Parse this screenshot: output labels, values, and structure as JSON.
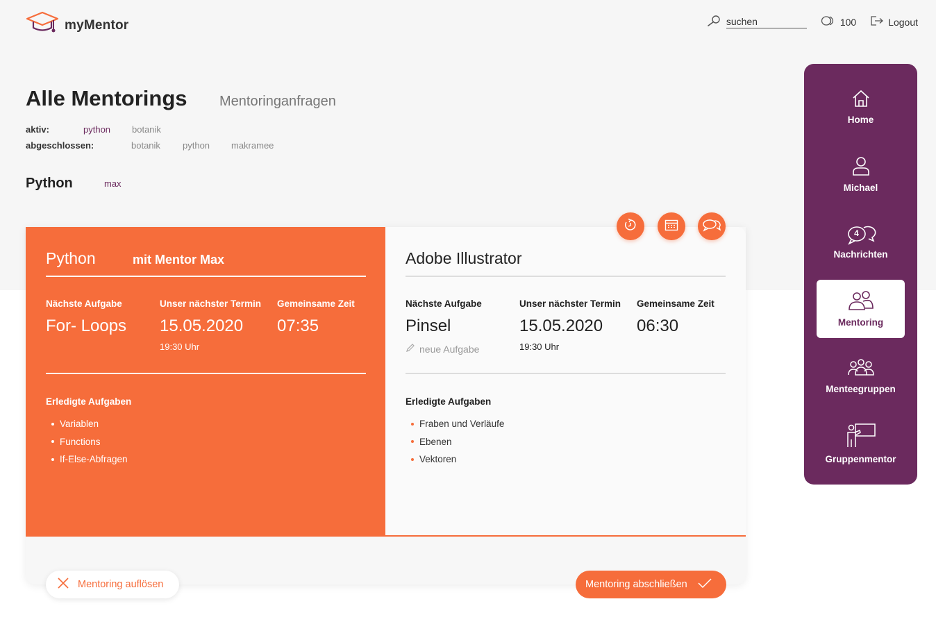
{
  "app": {
    "name": "myMentor"
  },
  "topbar": {
    "search_label": "suchen",
    "coins": "100",
    "logout_label": "Logout"
  },
  "page": {
    "title": "Alle Mentorings",
    "requests_link": "Mentoringanfragen"
  },
  "filters": {
    "active_label": "aktiv:",
    "active": [
      "python",
      "botanik"
    ],
    "done_label": "abgeschlossen:",
    "done": [
      "botanik",
      "python",
      "makramee"
    ]
  },
  "section": {
    "title": "Python",
    "subtitle": "max"
  },
  "left_panel": {
    "title": "Python",
    "mentor": "mit Mentor Max",
    "next_task_h": "Nächste Aufgabe",
    "next_task": "For- Loops",
    "appt_h": "Unser nächster Termin",
    "appt_date": "15.05.2020",
    "appt_time": "19:30 Uhr",
    "time_h": "Gemeinsame Zeit",
    "time_value": "07:35",
    "done_h": "Erledigte Aufgaben",
    "done": [
      "Variablen",
      "Functions",
      "If-Else-Abfragen"
    ]
  },
  "right_panel": {
    "title": "Adobe Illustrator",
    "next_task_h": "Nächste Aufgabe",
    "next_task": "Pinsel",
    "new_task": "neue Aufgabe",
    "appt_h": "Unser nächster Termin",
    "appt_date": "15.05.2020",
    "appt_time": "19:30 Uhr",
    "time_h": "Gemeinsame Zeit",
    "time_value": "06:30",
    "done_h": "Erledigte Aufgaben",
    "done": [
      "Fraben und Verläufe",
      "Ebenen",
      "Vektoren"
    ]
  },
  "actions": {
    "dissolve": "Mentoring auflösen",
    "finish": "Mentoring abschließen"
  },
  "sidebar": {
    "items": [
      {
        "label": "Home",
        "icon": "home-icon"
      },
      {
        "label": "Michael",
        "icon": "user-icon"
      },
      {
        "label": "Nachrichten",
        "icon": "messages-icon",
        "badge": "4"
      },
      {
        "label": "Mentoring",
        "icon": "mentoring-icon",
        "active": true
      },
      {
        "label": "Menteegruppen",
        "icon": "groups-icon"
      },
      {
        "label": "Gruppenmentor",
        "icon": "group-mentor-icon"
      }
    ]
  },
  "colors": {
    "accent": "#f66d3b",
    "brand": "#6b2a5e",
    "background": "#f6f6f6"
  }
}
